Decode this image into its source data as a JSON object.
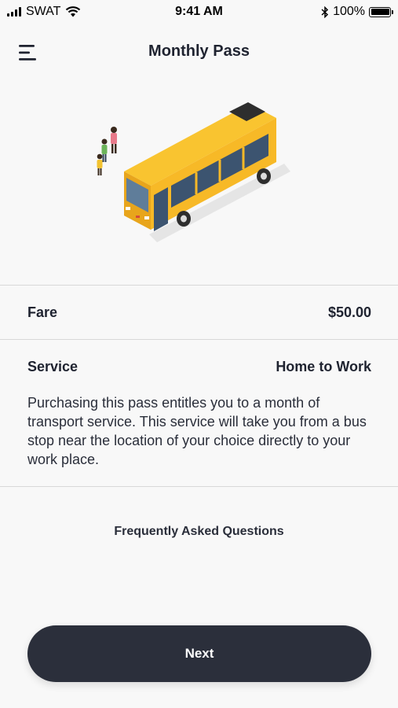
{
  "status_bar": {
    "carrier": "SWAT",
    "time": "9:41 AM",
    "battery_percent": "100%",
    "icons": [
      "signal-icon",
      "wifi-icon",
      "bluetooth-icon",
      "battery-icon"
    ]
  },
  "header": {
    "title": "Monthly Pass",
    "menu_icon": "menu-icon"
  },
  "hero": {
    "illustration": "bus-illustration",
    "accent_color": "#f7b927"
  },
  "fare": {
    "label": "Fare",
    "value": "$50.00"
  },
  "service": {
    "label": "Service",
    "value": "Home to Work",
    "description": "Purchasing this pass entitles you to a month of transport service. This service will take you from a bus stop near the location of your choice directly to your work place."
  },
  "faq": {
    "label": "Frequently Asked Questions"
  },
  "next_button": {
    "label": "Next",
    "color": "#2b2f3b"
  }
}
